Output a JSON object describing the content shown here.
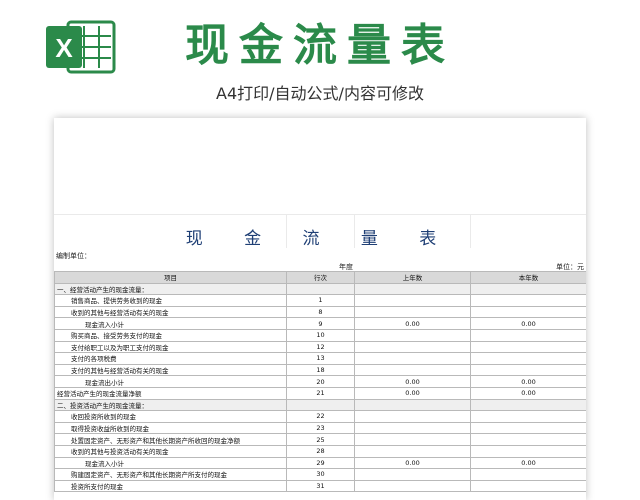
{
  "banner": {
    "title": "现金流量表",
    "subtitle": "A4打印/自动公式/内容可修改",
    "logo_letter": "X",
    "accent": "#2b8a4a"
  },
  "sheet": {
    "title": "现 金 流 量 表",
    "unit_left": "编制单位：",
    "year_label": "年度",
    "unit_right": "单位：元",
    "headers": [
      "项目",
      "行次",
      "上年数",
      "本年数"
    ],
    "rows": [
      {
        "item": "一、经营活动产生的现金流量：",
        "line": "",
        "prev": "",
        "curr": "",
        "indent": 0,
        "section": true
      },
      {
        "item": "销售商品、提供劳务收到的现金",
        "line": "1",
        "prev": "",
        "curr": "",
        "indent": 1
      },
      {
        "item": "收到的其他与经营活动有关的现金",
        "line": "8",
        "prev": "",
        "curr": "",
        "indent": 1
      },
      {
        "item": "现金流入小计",
        "line": "9",
        "prev": "0.00",
        "curr": "0.00",
        "indent": 2
      },
      {
        "item": "购买商品、接受劳务支付的现金",
        "line": "10",
        "prev": "",
        "curr": "",
        "indent": 1
      },
      {
        "item": "支付给职工以及为职工支付的现金",
        "line": "12",
        "prev": "",
        "curr": "",
        "indent": 1
      },
      {
        "item": "支付的各项税费",
        "line": "13",
        "prev": "",
        "curr": "",
        "indent": 1
      },
      {
        "item": "支付的其他与经营活动有关的现金",
        "line": "18",
        "prev": "",
        "curr": "",
        "indent": 1
      },
      {
        "item": "现金流出小计",
        "line": "20",
        "prev": "0.00",
        "curr": "0.00",
        "indent": 2
      },
      {
        "item": "经营活动产生的现金流量净额",
        "line": "21",
        "prev": "0.00",
        "curr": "0.00",
        "indent": 0
      },
      {
        "item": "二、投资活动产生的现金流量：",
        "line": "",
        "prev": "",
        "curr": "",
        "indent": 0,
        "section": true
      },
      {
        "item": "收回投资所收到的现金",
        "line": "22",
        "prev": "",
        "curr": "",
        "indent": 1
      },
      {
        "item": "取得投资收益所收到的现金",
        "line": "23",
        "prev": "",
        "curr": "",
        "indent": 1
      },
      {
        "item": "处置固定资产、无形资产和其他长期资产所收回的现金净额",
        "line": "25",
        "prev": "",
        "curr": "",
        "indent": 1
      },
      {
        "item": "收到的其他与投资活动有关的现金",
        "line": "28",
        "prev": "",
        "curr": "",
        "indent": 1
      },
      {
        "item": "现金流入小计",
        "line": "29",
        "prev": "0.00",
        "curr": "0.00",
        "indent": 2
      },
      {
        "item": "购建固定资产、无形资产和其他长期资产所支付的现金",
        "line": "30",
        "prev": "",
        "curr": "",
        "indent": 1
      },
      {
        "item": "投资所支付的现金",
        "line": "31",
        "prev": "",
        "curr": "",
        "indent": 1
      }
    ]
  }
}
